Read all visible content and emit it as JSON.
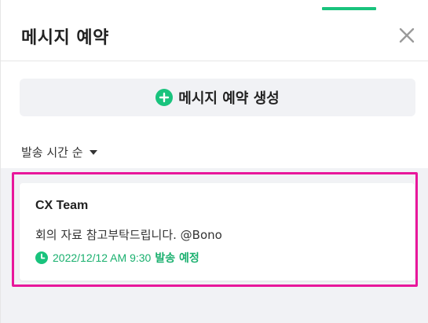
{
  "colors": {
    "accent": "#19c37d",
    "highlight": "#e8179b",
    "list_bg": "#f1f2f5"
  },
  "header": {
    "title": "메시지 예약",
    "close_icon": "close-icon"
  },
  "create_button": {
    "icon": "plus-circle-icon",
    "label": "메시지 예약 생성"
  },
  "sort": {
    "label": "발송 시간 순",
    "icon": "caret-down-icon"
  },
  "scheduled_messages": [
    {
      "recipient": "CX Team",
      "message": "회의 자료 참고부탁드립니다. @Bono",
      "icon": "clock-icon",
      "datetime": "2022/12/12 AM 9:30",
      "status": "발송 예정"
    }
  ]
}
